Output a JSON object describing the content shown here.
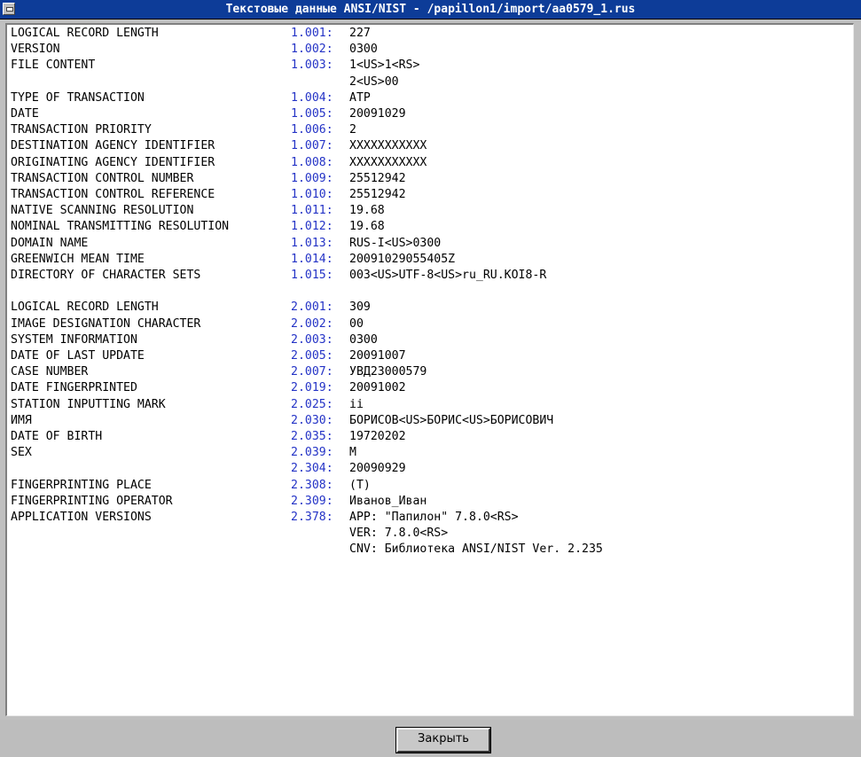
{
  "window": {
    "title": "Текстовые данные ANSI/NIST - /papillon1/import/aa0579_1.rus"
  },
  "records": [
    {
      "label": "LOGICAL RECORD LENGTH",
      "field": "1.001:",
      "value": "227"
    },
    {
      "label": "VERSION",
      "field": "1.002:",
      "value": "0300"
    },
    {
      "label": "FILE CONTENT",
      "field": "1.003:",
      "value": "1<US>1<RS>"
    },
    {
      "label": "",
      "field": "",
      "value": "2<US>00"
    },
    {
      "label": "TYPE OF TRANSACTION",
      "field": "1.004:",
      "value": "ATP"
    },
    {
      "label": "DATE",
      "field": "1.005:",
      "value": "20091029"
    },
    {
      "label": "TRANSACTION PRIORITY",
      "field": "1.006:",
      "value": "2"
    },
    {
      "label": "DESTINATION AGENCY IDENTIFIER",
      "field": "1.007:",
      "value": "XXXXXXXXXXX"
    },
    {
      "label": "ORIGINATING AGENCY IDENTIFIER",
      "field": "1.008:",
      "value": "XXXXXXXXXXX"
    },
    {
      "label": "TRANSACTION CONTROL NUMBER",
      "field": "1.009:",
      "value": "25512942"
    },
    {
      "label": "TRANSACTION CONTROL REFERENCE",
      "field": "1.010:",
      "value": "25512942"
    },
    {
      "label": "NATIVE SCANNING RESOLUTION",
      "field": "1.011:",
      "value": "19.68"
    },
    {
      "label": "NOMINAL TRANSMITTING RESOLUTION",
      "field": "1.012:",
      "value": "19.68"
    },
    {
      "label": "DOMAIN NAME",
      "field": "1.013:",
      "value": "RUS-I<US>0300"
    },
    {
      "label": "GREENWICH MEAN TIME",
      "field": "1.014:",
      "value": "20091029055405Z"
    },
    {
      "label": "DIRECTORY OF CHARACTER SETS",
      "field": "1.015:",
      "value": "003<US>UTF-8<US>ru_RU.KOI8-R"
    },
    {
      "label": "",
      "field": "",
      "value": ""
    },
    {
      "label": "LOGICAL RECORD LENGTH",
      "field": "2.001:",
      "value": "309"
    },
    {
      "label": "IMAGE DESIGNATION CHARACTER",
      "field": "2.002:",
      "value": "00"
    },
    {
      "label": "SYSTEM INFORMATION",
      "field": "2.003:",
      "value": "0300"
    },
    {
      "label": "DATE OF LAST UPDATE",
      "field": "2.005:",
      "value": "20091007"
    },
    {
      "label": "CASE NUMBER",
      "field": "2.007:",
      "value": "УВД23000579"
    },
    {
      "label": "DATE FINGERPRINTED",
      "field": "2.019:",
      "value": "20091002"
    },
    {
      "label": "STATION INPUTTING MARK",
      "field": "2.025:",
      "value": "ii"
    },
    {
      "label": "ИМЯ",
      "field": "2.030:",
      "value": "БОРИСОВ<US>БОРИС<US>БОРИСОВИЧ"
    },
    {
      "label": "DATE OF BIRTH",
      "field": "2.035:",
      "value": "19720202"
    },
    {
      "label": "SEX",
      "field": "2.039:",
      "value": "M"
    },
    {
      "label": "",
      "field": "2.304:",
      "value": "20090929"
    },
    {
      "label": "FINGERPRINTING PLACE",
      "field": "2.308:",
      "value": "(T)"
    },
    {
      "label": "FINGERPRINTING OPERATOR",
      "field": "2.309:",
      "value": "Иванов_Иван"
    },
    {
      "label": "APPLICATION VERSIONS",
      "field": "2.378:",
      "value": "APP: \"Папилон\" 7.8.0<RS>"
    },
    {
      "label": "",
      "field": "",
      "value": "VER: 7.8.0<RS>"
    },
    {
      "label": "",
      "field": "",
      "value": "CNV: Библиотека ANSI/NIST Ver. 2.235"
    }
  ],
  "footer": {
    "close_label": "Закрыть"
  },
  "colors": {
    "titlebar": "#0d3c98",
    "field_number": "#2433c6"
  }
}
